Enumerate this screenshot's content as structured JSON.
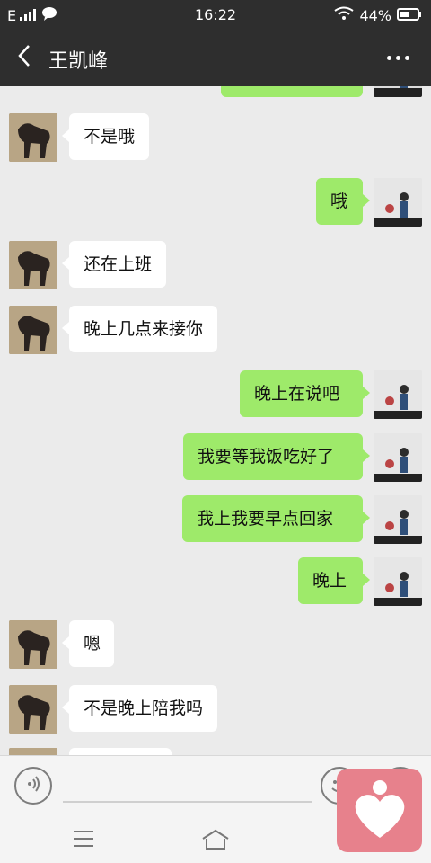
{
  "status": {
    "network": "E",
    "time": "16:22",
    "battery": "44%"
  },
  "header": {
    "title": "王凯峰"
  },
  "messages": [
    {
      "side": "out",
      "text": ""
    },
    {
      "side": "in",
      "text": "不是哦"
    },
    {
      "side": "out",
      "text": "哦"
    },
    {
      "side": "in",
      "text": "还在上班"
    },
    {
      "side": "in",
      "text": "晚上几点来接你"
    },
    {
      "side": "out",
      "text": "晚上在说吧"
    },
    {
      "side": "out",
      "text": "我要等我饭吃好了"
    },
    {
      "side": "out",
      "text": "我上我要早点回家"
    },
    {
      "side": "out",
      "text": "晚上"
    },
    {
      "side": "in",
      "text": "嗯"
    },
    {
      "side": "in",
      "text": "不是晚上陪我吗"
    },
    {
      "side": "in",
      "text": ""
    }
  ],
  "icons": {
    "back": "chevron-left-icon",
    "more": "more-dots-icon",
    "voice": "voice-icon",
    "emoji": "emoji-icon",
    "plus": "plus-icon",
    "menu": "menu-icon",
    "home": "home-icon",
    "app": "heart-app-icon"
  },
  "colors": {
    "header_bg": "#2e2e2e",
    "chat_bg": "#ebebeb",
    "outgoing_bubble": "#9eea6a",
    "incoming_bubble": "#ffffff",
    "app_badge": "#e7818c"
  }
}
